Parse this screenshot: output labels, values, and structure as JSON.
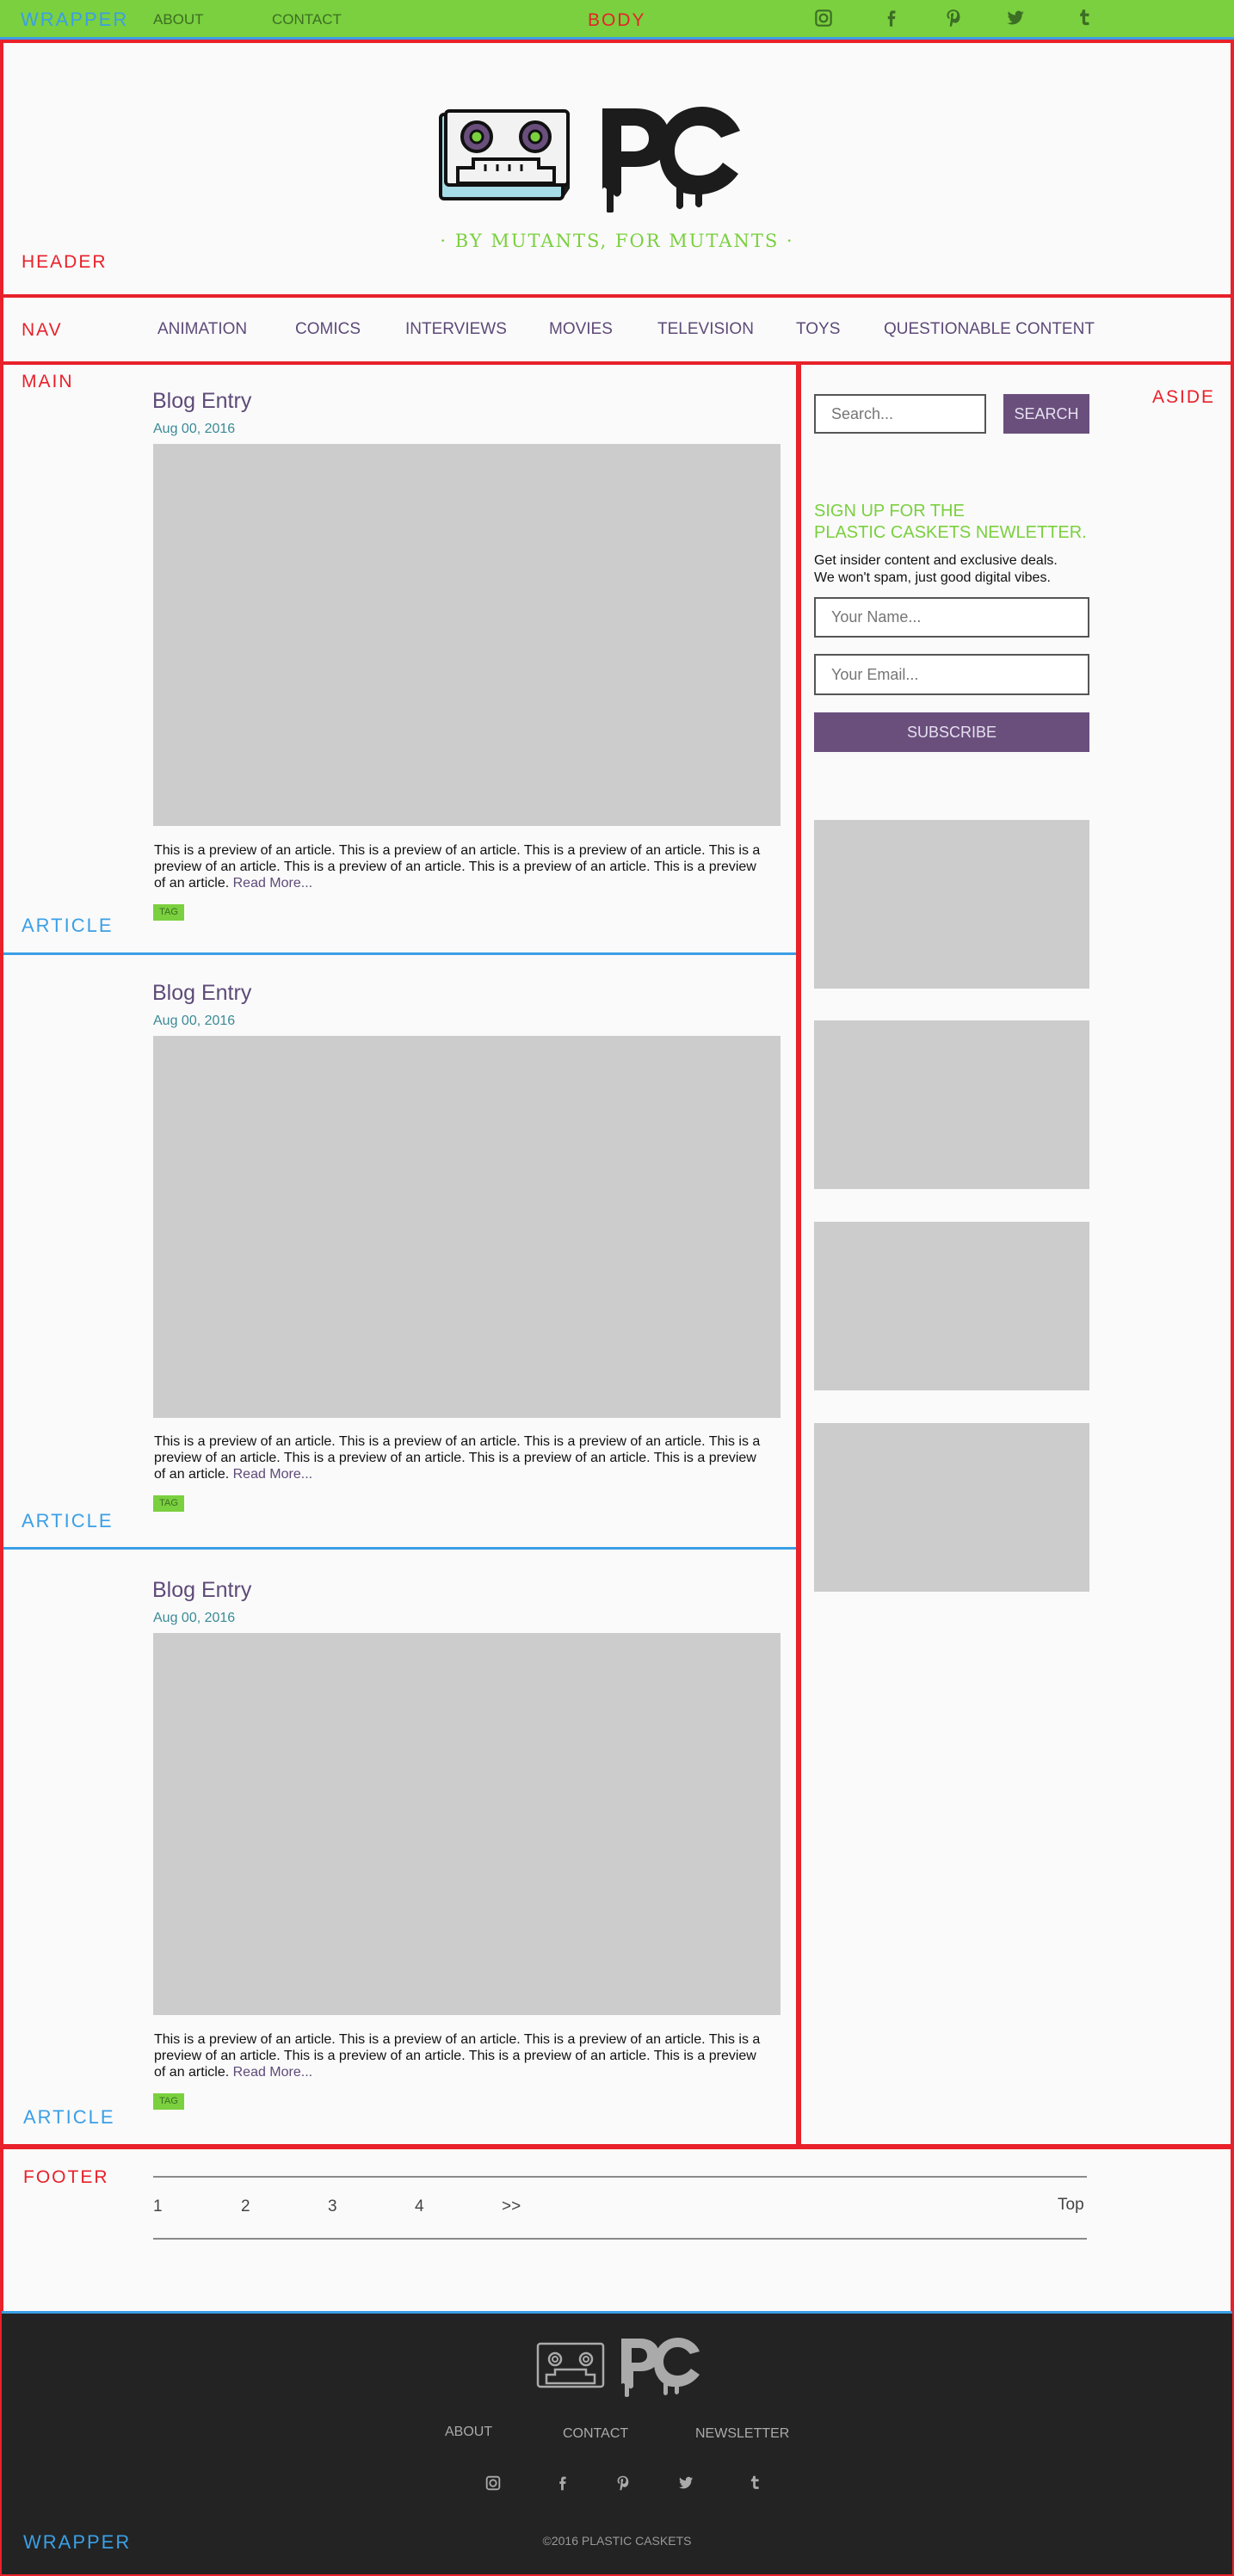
{
  "debug_labels": {
    "wrapper_top": "WRAPPER",
    "body": "BODY",
    "header": "HEADER",
    "nav": "NAV",
    "main": "MAIN",
    "aside": "ASIDE",
    "article": "ARTICLE",
    "footer": "FOOTER",
    "wrapper_bottom": "WRAPPER"
  },
  "topbar": {
    "links": [
      "ABOUT",
      "CONTACT"
    ],
    "social_icons": [
      "instagram-icon",
      "facebook-icon",
      "pinterest-icon",
      "twitter-icon",
      "tumblr-icon"
    ]
  },
  "header": {
    "logo_text": "PC",
    "tagline": "· BY MUTANTS, FOR MUTANTS ·"
  },
  "nav": {
    "items": [
      "ANIMATION",
      "COMICS",
      "INTERVIEWS",
      "MOVIES",
      "TELEVISION",
      "TOYS",
      "QUESTIONABLE CONTENT"
    ]
  },
  "articles": [
    {
      "title": "Blog Entry",
      "date": "Aug 00, 2016",
      "preview": "This is a preview of an article. This is a preview of an article. This is a preview of an article. This is a preview of an article. This is a preview of an article. This is a preview of an article. This is a preview of an article.",
      "read_more": "Read More...",
      "tag": "TAG"
    },
    {
      "title": "Blog Entry",
      "date": "Aug 00, 2016",
      "preview": "This is a preview of an article. This is a preview of an article. This is a preview of an article. This is a preview of an article. This is a preview of an article. This is a preview of an article. This is a preview of an article.",
      "read_more": "Read More...",
      "tag": "TAG"
    },
    {
      "title": "Blog Entry",
      "date": "Aug 00, 2016",
      "preview": "This is a preview of an article. This is a preview of an article. This is a preview of an article. This is a preview of an article. This is a preview of an article. This is a preview of an article. This is a preview of an article.",
      "read_more": "Read More...",
      "tag": "TAG"
    }
  ],
  "aside": {
    "search_placeholder": "Search...",
    "search_button": "SEARCH",
    "newsletter_title_1": "SIGN UP FOR THE",
    "newsletter_title_2": "PLASTIC CASKETS NEWLETTER.",
    "newsletter_text_1": "Get insider content and exclusive deals.",
    "newsletter_text_2": "We won't spam, just good digital vibes.",
    "name_placeholder": "Your Name...",
    "email_placeholder": "Your Email...",
    "subscribe_button": "SUBSCRIBE"
  },
  "pagination": {
    "pages": [
      "1",
      "2",
      "3",
      "4",
      ">>"
    ],
    "current": "1",
    "top_link": "Top"
  },
  "footer": {
    "logo_text": "PC",
    "links": [
      "ABOUT",
      "CONTACT",
      "NEWSLETTER"
    ],
    "social_icons": [
      "instagram-icon",
      "facebook-icon",
      "pinterest-icon",
      "twitter-icon",
      "tumblr-icon"
    ],
    "copyright": "©2016 PLASTIC CASKETS"
  },
  "colors": {
    "accent_green": "#7ad03e",
    "brand_purple": "#5e4a78",
    "debug_red": "#e8212a",
    "debug_blue": "#3b9fe6",
    "footer_dark": "#232323"
  }
}
